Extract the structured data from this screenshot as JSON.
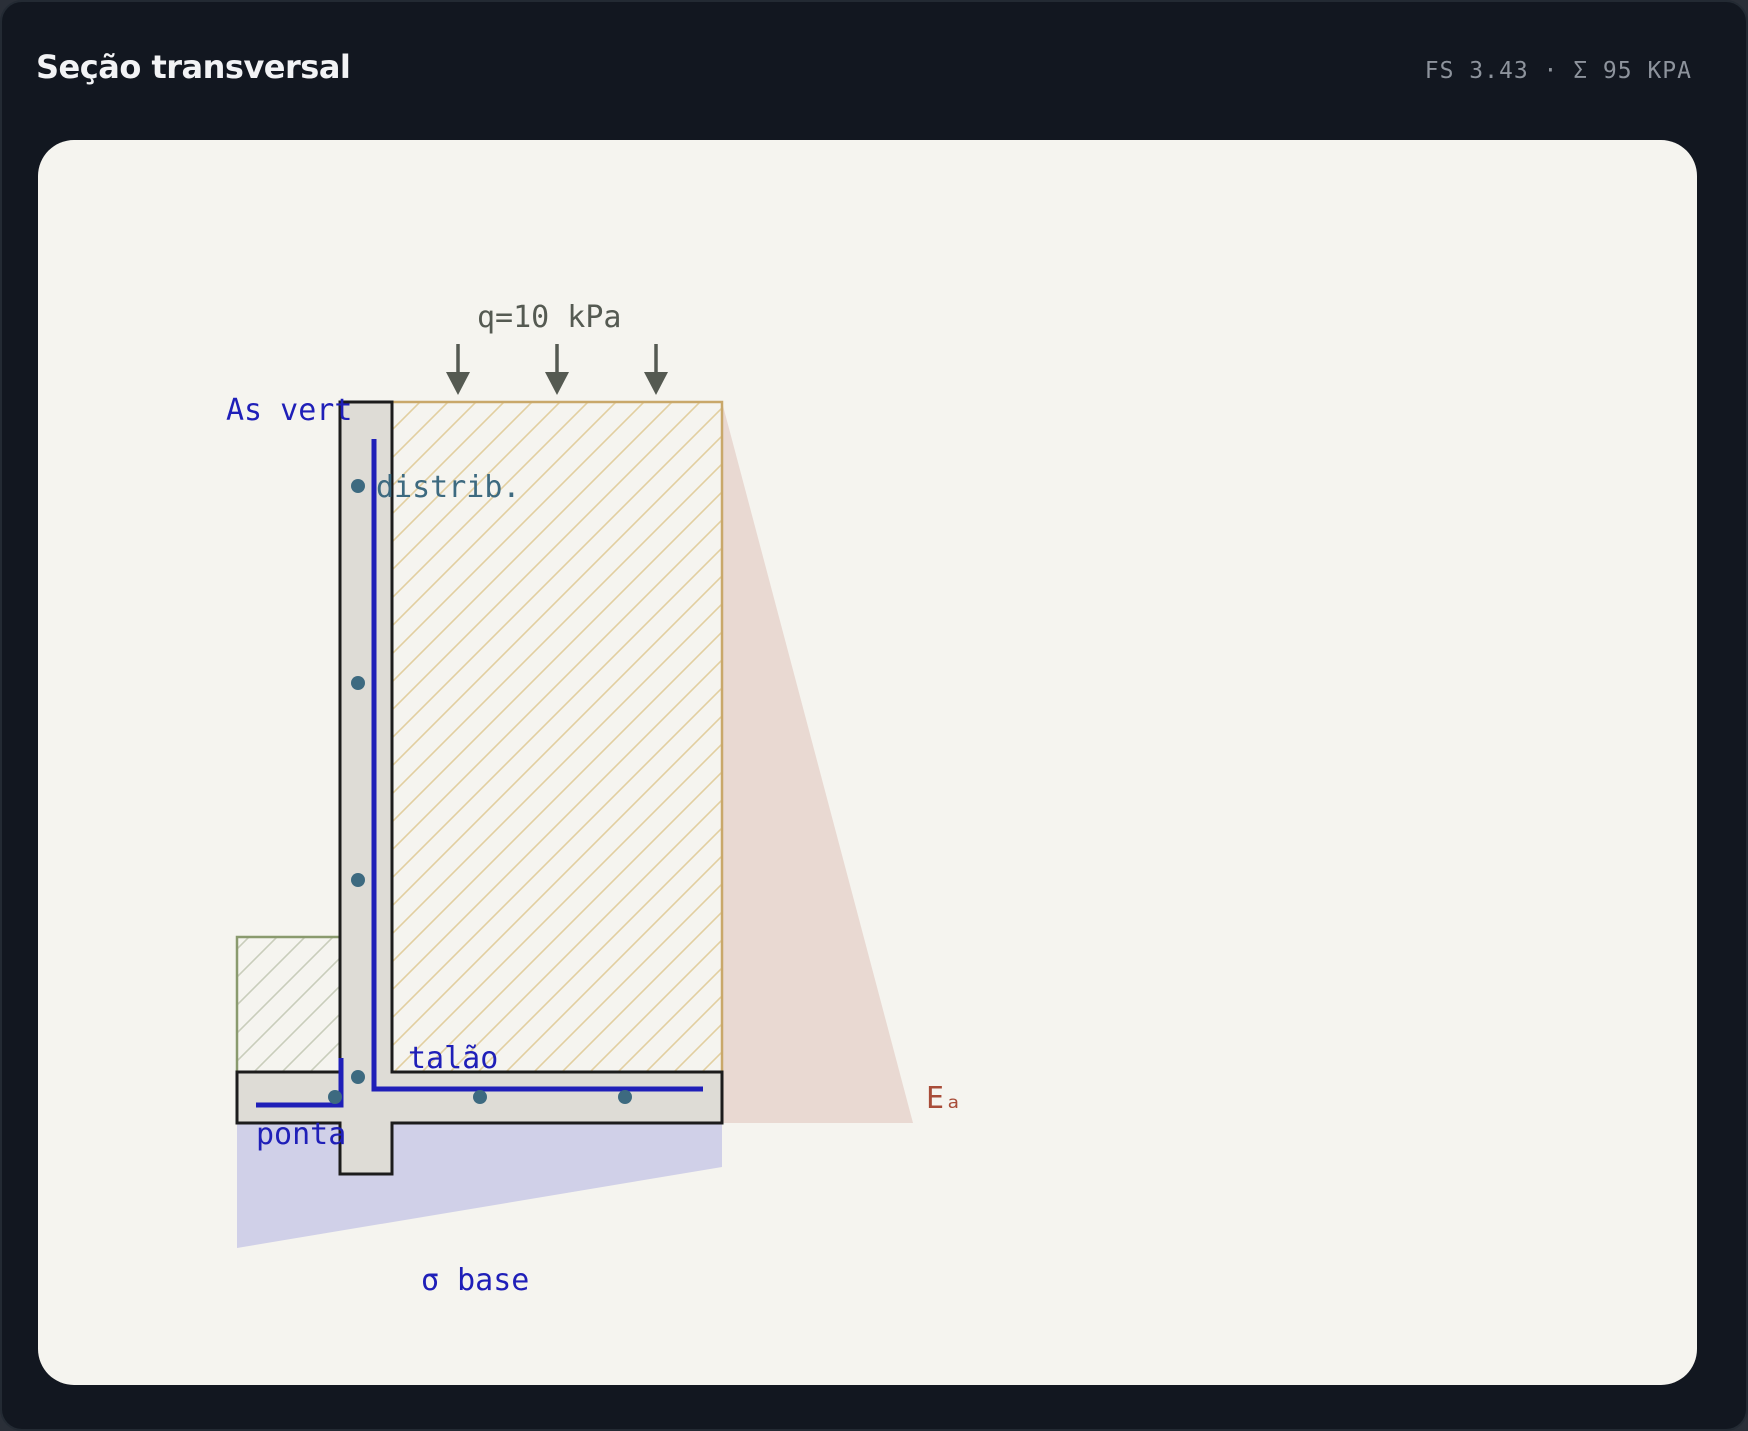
{
  "header": {
    "title": "Seção transversal",
    "summary": "FS 3.43 · Σ 95 KPA"
  },
  "diagram": {
    "surcharge_label": "q=10 kPa",
    "vertical_rebar_label": "As vert",
    "distribution_bars_label": "distrib.",
    "heel_label": "talão",
    "toe_label": "ponta",
    "active_thrust_label": "Eₐ",
    "base_pressure_label": "σ base"
  },
  "colors": {
    "background": "#121720",
    "canvas": "#f5f4ef",
    "concrete": "#dedcd6",
    "outline": "#1c1c1c",
    "backfill_hatch": "#c9a86a",
    "toe_soil_hatch": "#8a9a6e",
    "rebar": "#1f1fb8",
    "bars_dots": "#3d6a80",
    "thrust_fill": "#e9d9d2",
    "thrust_text": "#a84c38",
    "base_pressure_fill": "#d0d0e8",
    "load_arrows": "#555a52"
  }
}
